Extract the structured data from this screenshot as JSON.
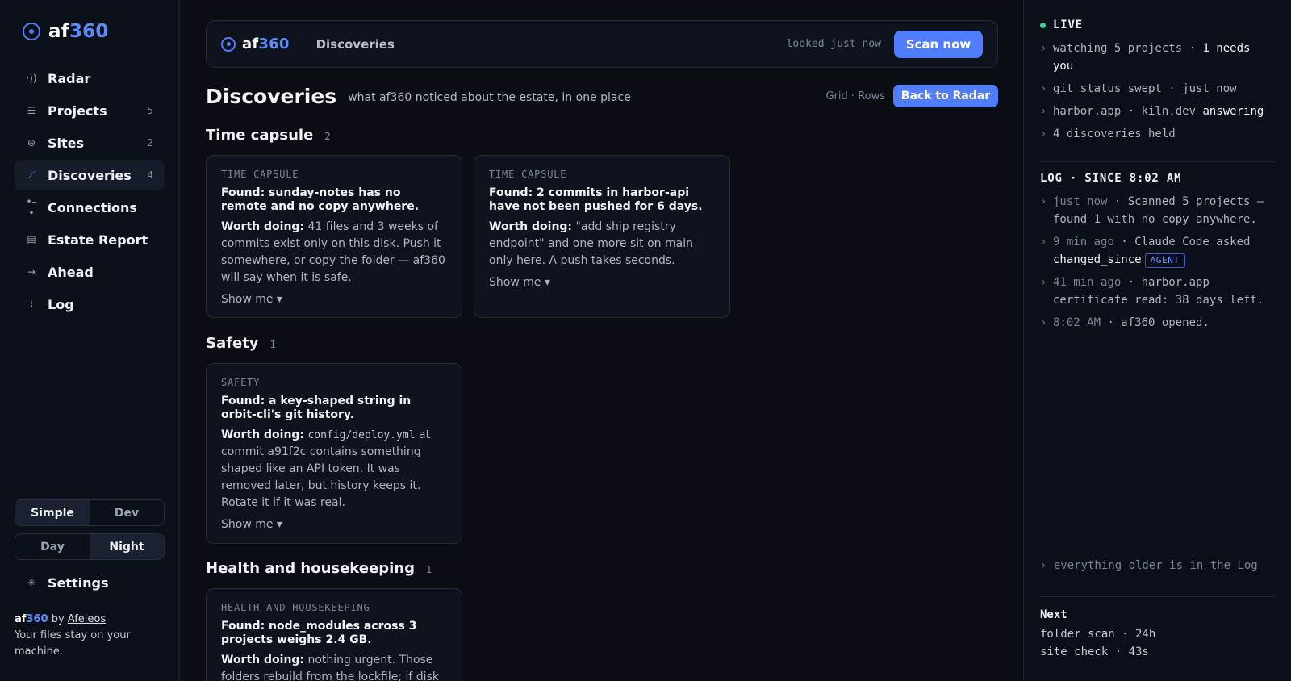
{
  "brand": {
    "name_a": "af",
    "name_b": "360"
  },
  "sidebar": {
    "items": [
      {
        "label": "Radar",
        "count": "",
        "icon": "radar-icon",
        "glyph": "·))"
      },
      {
        "label": "Projects",
        "count": "5",
        "icon": "list-icon",
        "glyph": "☰"
      },
      {
        "label": "Sites",
        "count": "2",
        "icon": "globe-icon",
        "glyph": "⊖"
      },
      {
        "label": "Discoveries",
        "count": "4",
        "icon": "trend-icon",
        "glyph": "⟋"
      },
      {
        "label": "Connections",
        "count": "",
        "icon": "connection-icon",
        "glyph": "•–•"
      },
      {
        "label": "Estate Report",
        "count": "",
        "icon": "document-icon",
        "glyph": "▤"
      },
      {
        "label": "Ahead",
        "count": "",
        "icon": "arrow-ahead-icon",
        "glyph": "→"
      },
      {
        "label": "Log",
        "count": "",
        "icon": "pulse-icon",
        "glyph": "⌇"
      }
    ],
    "mode": {
      "simple": "Simple",
      "dev": "Dev",
      "selected": "Simple"
    },
    "theme": {
      "day": "Day",
      "night": "Night",
      "selected": "Night"
    },
    "settings_label": "Settings",
    "footer": {
      "by": " by ",
      "author": "Afeleos",
      "note": "Your files stay on your machine."
    }
  },
  "topbar": {
    "crumb": "Discoveries",
    "looked": "looked just now",
    "scan_label": "Scan now"
  },
  "page": {
    "title": "Discoveries",
    "subtitle": "what af360 noticed about the estate, in one place",
    "view_grid": "Grid",
    "view_sep": " · ",
    "view_rows": "Rows",
    "back_label": "Back to Radar"
  },
  "sections": [
    {
      "title": "Time capsule",
      "count": "2"
    },
    {
      "title": "Safety",
      "count": "1"
    },
    {
      "title": "Health and housekeeping",
      "count": "1"
    }
  ],
  "cards": [
    {
      "kicker": "TIME CAPSULE",
      "found": "Found: sunday-notes has no remote and no copy anywhere.",
      "worth_label": "Worth doing:",
      "worth_text": " 41 files and 3 weeks of commits exist only on this disk. Push it somewhere, or copy the folder — af360 will say when it is safe.",
      "show": "Show me ▾"
    },
    {
      "kicker": "TIME CAPSULE",
      "found": "Found: 2 commits in harbor-api have not been pushed for 6 days.",
      "worth_label": "Worth doing:",
      "worth_text": " \"add ship registry endpoint\" and one more sit on main only here. A push takes seconds.",
      "show": "Show me ▾"
    },
    {
      "kicker": "SAFETY",
      "found": "Found: a key-shaped string in orbit-cli's git history.",
      "worth_label": "Worth doing:",
      "worth_code": "config/deploy.yml",
      "worth_text": " at commit a91f2c contains something shaped like an API token. It was removed later, but history keeps it. Rotate it if it was real.",
      "show": "Show me ▾"
    },
    {
      "kicker": "HEALTH AND HOUSEKEEPING",
      "found": "Found: node_modules across 3 projects weighs 2.4 GB.",
      "worth_label": "Worth doing:",
      "worth_text": " nothing urgent. Those folders rebuild from the lockfile; if disk"
    }
  ],
  "right": {
    "live_label": "LIVE",
    "live_rows": [
      {
        "pre": "watching 5 projects · ",
        "em": "1 needs you"
      },
      {
        "pre": "git status swept · just now",
        "em": ""
      },
      {
        "pre": "harbor.app · kiln.dev ",
        "em": "answering"
      },
      {
        "pre": "4 discoveries held",
        "em": ""
      }
    ],
    "log_title": "LOG · SINCE 8:02 AM",
    "log_rows": [
      {
        "time": "just now",
        "text": " · Scanned 5 projects — found 1 with no copy anywhere.",
        "em": "",
        "badge": ""
      },
      {
        "time": "9 min ago",
        "text": " · Claude Code asked ",
        "em": "changed_since",
        "badge": "AGENT"
      },
      {
        "time": "41 min ago",
        "text": " · harbor.app certificate read: 38 days left.",
        "em": "",
        "badge": ""
      },
      {
        "time": "8:02 AM",
        "text": " · af360 opened.",
        "em": "",
        "badge": ""
      }
    ],
    "older": "everything older is in the Log",
    "next_title": "Next",
    "next_rows": [
      "folder scan · 24h",
      "site check · 43s"
    ],
    "live_color": "#34d399",
    "accent_color": "#4f7dfb"
  }
}
